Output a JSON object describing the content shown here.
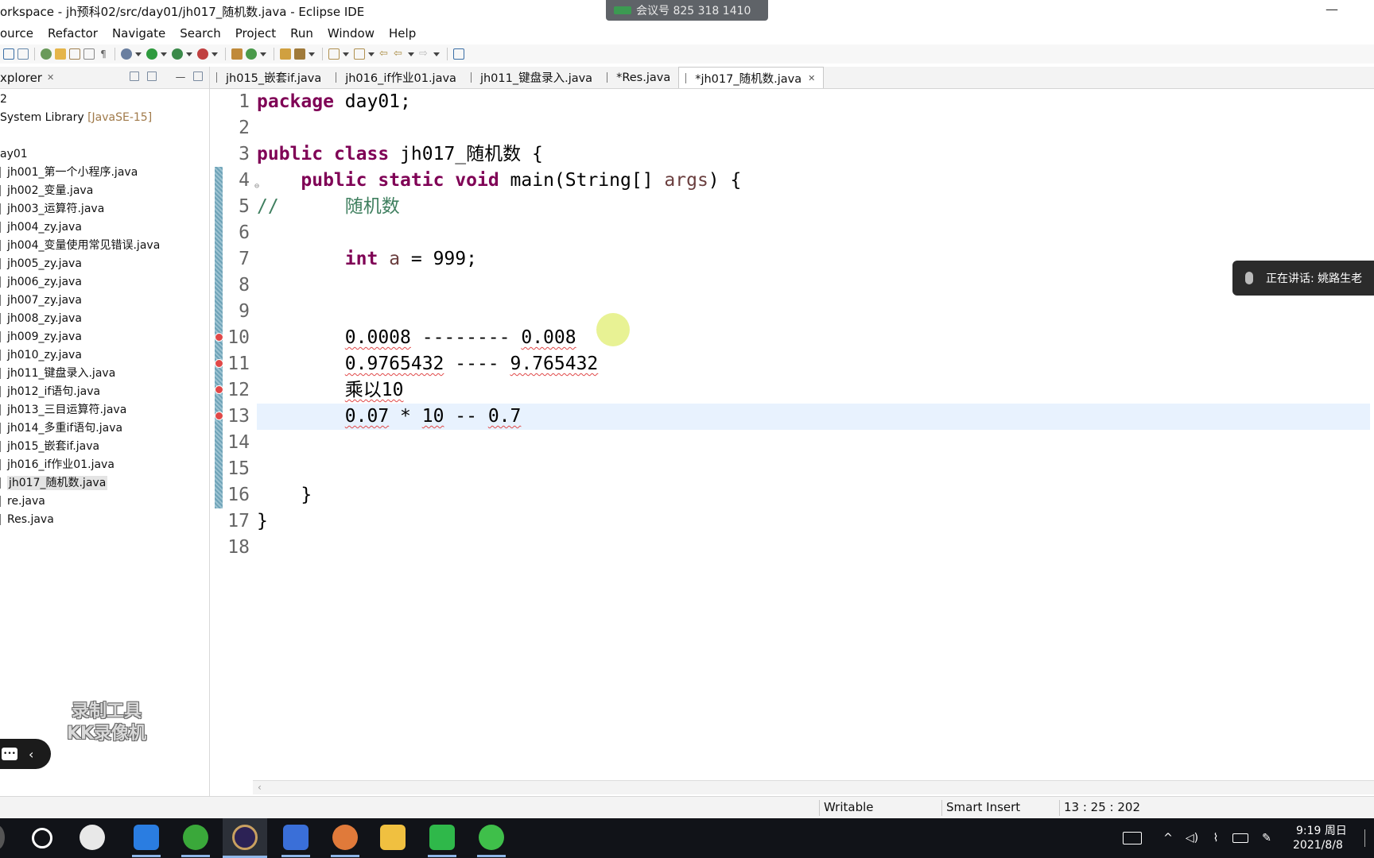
{
  "window": {
    "title": "orkspace - jh预科02/src/day01/jh017_随机数.java - Eclipse IDE",
    "meeting_badge": "会议号 825 318 1410",
    "minimize": "—"
  },
  "menu": [
    "ource",
    "Refactor",
    "Navigate",
    "Search",
    "Project",
    "Run",
    "Window",
    "Help"
  ],
  "explorer": {
    "title": "xplorer",
    "close": "✕",
    "tree": [
      {
        "label": "2",
        "file": false
      },
      {
        "label": "System Library ",
        "lib": "[JavaSE-15]",
        "file": false
      },
      {
        "label": "",
        "file": false
      },
      {
        "label": "ay01",
        "file": false
      },
      {
        "label": "jh001_第一个小程序.java",
        "file": true
      },
      {
        "label": "jh002_变量.java",
        "file": true
      },
      {
        "label": "jh003_运算符.java",
        "file": true
      },
      {
        "label": "jh004_zy.java",
        "file": true
      },
      {
        "label": "jh004_变量使用常见错误.java",
        "file": true
      },
      {
        "label": "jh005_zy.java",
        "file": true
      },
      {
        "label": "jh006_zy.java",
        "file": true
      },
      {
        "label": "jh007_zy.java",
        "file": true
      },
      {
        "label": "jh008_zy.java",
        "file": true
      },
      {
        "label": "jh009_zy.java",
        "file": true
      },
      {
        "label": "jh010_zy.java",
        "file": true
      },
      {
        "label": "jh011_键盘录入.java",
        "file": true
      },
      {
        "label": "jh012_if语句.java",
        "file": true
      },
      {
        "label": "jh013_三目运算符.java",
        "file": true
      },
      {
        "label": "jh014_多重if语句.java",
        "file": true
      },
      {
        "label": "jh015_嵌套if.java",
        "file": true
      },
      {
        "label": "jh016_if作业01.java",
        "file": true
      },
      {
        "label": "jh017_随机数.java",
        "file": true,
        "selected": true
      },
      {
        "label": "re.java",
        "file": true
      },
      {
        "label": "Res.java",
        "file": true
      }
    ]
  },
  "recorder": {
    "logo_line1": "录制工具",
    "logo_line2": "KK录像机"
  },
  "tabs": [
    {
      "label": "jh015_嵌套if.java",
      "active": false
    },
    {
      "label": "jh016_if作业01.java",
      "active": false
    },
    {
      "label": "jh011_键盘录入.java",
      "active": false
    },
    {
      "label": "*Res.java",
      "active": false
    },
    {
      "label": "*jh017_随机数.java",
      "active": true
    }
  ],
  "editor": {
    "lines": [
      {
        "n": "1",
        "segs": [
          [
            "kw",
            "package"
          ],
          [
            "",
            " day01;"
          ]
        ]
      },
      {
        "n": "2",
        "segs": []
      },
      {
        "n": "3",
        "segs": [
          [
            "kw",
            "public"
          ],
          [
            "",
            " "
          ],
          [
            "kw",
            "class"
          ],
          [
            "",
            " jh017_随机数 {"
          ]
        ]
      },
      {
        "n": "4",
        "fold": true,
        "segs": [
          [
            "",
            "    "
          ],
          [
            "kw",
            "public"
          ],
          [
            "",
            " "
          ],
          [
            "kw",
            "static"
          ],
          [
            "",
            " "
          ],
          [
            "kw",
            "void"
          ],
          [
            "",
            " main(String[] "
          ],
          [
            "vr",
            "args"
          ],
          [
            "",
            ") {"
          ]
        ]
      },
      {
        "n": "5",
        "segs": [
          [
            "cm",
            "//      随机数"
          ]
        ]
      },
      {
        "n": "6",
        "segs": []
      },
      {
        "n": "7",
        "segs": [
          [
            "",
            "        "
          ],
          [
            "kw",
            "int"
          ],
          [
            "",
            " "
          ],
          [
            "vr",
            "a"
          ],
          [
            "",
            " = 999;"
          ]
        ]
      },
      {
        "n": "8",
        "segs": []
      },
      {
        "n": "9",
        "segs": []
      },
      {
        "n": "10",
        "error": true,
        "segs": [
          [
            "",
            "        "
          ],
          [
            "sq",
            "0.0008"
          ],
          [
            "",
            " -------- "
          ],
          [
            "sq",
            "0.008"
          ]
        ]
      },
      {
        "n": "11",
        "error": true,
        "segs": [
          [
            "",
            "        "
          ],
          [
            "sq",
            "0.9765432"
          ],
          [
            "",
            " ---- "
          ],
          [
            "sq",
            "9.765432"
          ]
        ]
      },
      {
        "n": "12",
        "error": true,
        "segs": [
          [
            "",
            "        "
          ],
          [
            "sq",
            "乘以10"
          ]
        ]
      },
      {
        "n": "13",
        "error": true,
        "current": true,
        "segs": [
          [
            "",
            "        "
          ],
          [
            "sq",
            "0.07"
          ],
          [
            "",
            " * "
          ],
          [
            "sq",
            "10"
          ],
          [
            "",
            " -- "
          ],
          [
            "sq",
            "0.7"
          ]
        ]
      },
      {
        "n": "14",
        "segs": []
      },
      {
        "n": "15",
        "segs": []
      },
      {
        "n": "16",
        "segs": [
          [
            "",
            "    }"
          ]
        ]
      },
      {
        "n": "17",
        "segs": [
          [
            "",
            "}"
          ]
        ]
      },
      {
        "n": "18",
        "segs": []
      }
    ]
  },
  "speaker_toast": "正在讲话: 姚路生老",
  "status": {
    "mode": "Writable",
    "insert": "Smart Insert",
    "position": "13 : 25 : 202"
  },
  "taskbar": {
    "time": "9:19 周日",
    "date": "2021/8/8"
  }
}
